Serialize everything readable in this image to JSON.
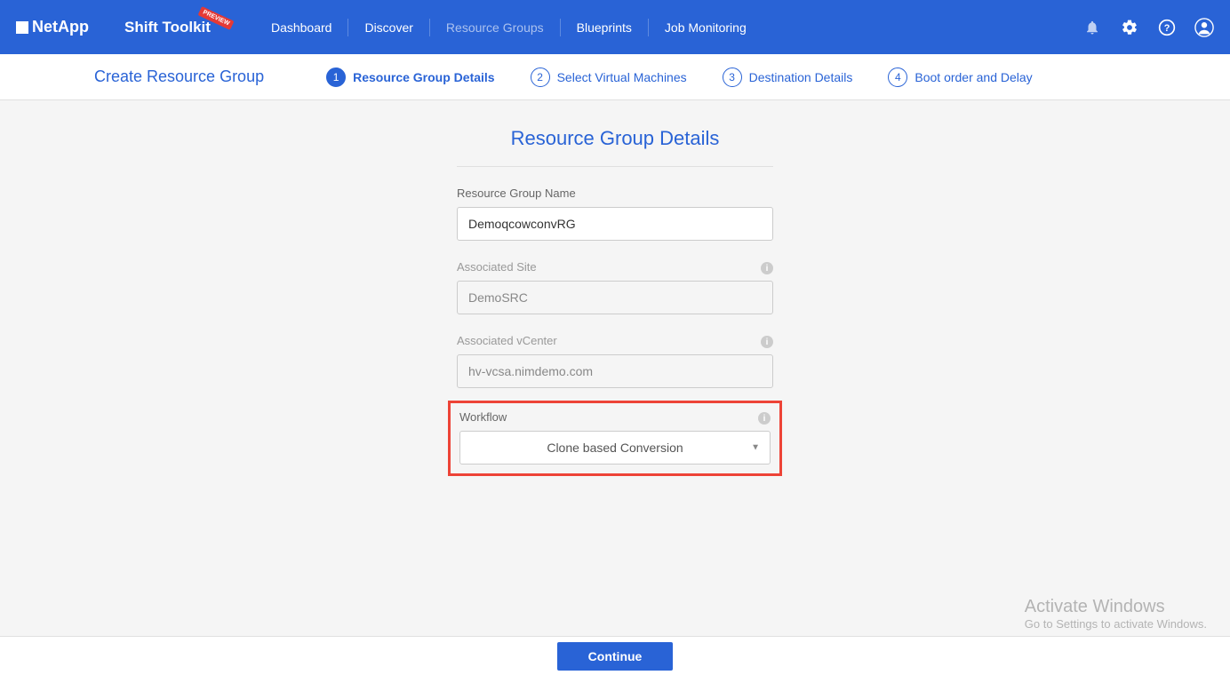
{
  "header": {
    "brand": "NetApp",
    "product": "Shift Toolkit",
    "badge": "PREVIEW",
    "nav": {
      "dashboard": "Dashboard",
      "discover": "Discover",
      "resource_groups": "Resource Groups",
      "blueprints": "Blueprints",
      "job_monitoring": "Job Monitoring"
    }
  },
  "wizard": {
    "title": "Create Resource Group",
    "steps": {
      "s1": {
        "num": "1",
        "label": "Resource Group Details"
      },
      "s2": {
        "num": "2",
        "label": "Select Virtual Machines"
      },
      "s3": {
        "num": "3",
        "label": "Destination Details"
      },
      "s4": {
        "num": "4",
        "label": "Boot order and Delay"
      }
    }
  },
  "form": {
    "section_title": "Resource Group Details",
    "rg_name": {
      "label": "Resource Group Name",
      "value": "DemoqcowconvRG"
    },
    "site": {
      "label": "Associated Site",
      "value": "DemoSRC"
    },
    "vcenter": {
      "label": "Associated vCenter",
      "value": "hv-vcsa.nimdemo.com"
    },
    "workflow": {
      "label": "Workflow",
      "value": "Clone based Conversion"
    }
  },
  "footer": {
    "continue": "Continue"
  },
  "watermark": {
    "title": "Activate Windows",
    "sub": "Go to Settings to activate Windows."
  }
}
